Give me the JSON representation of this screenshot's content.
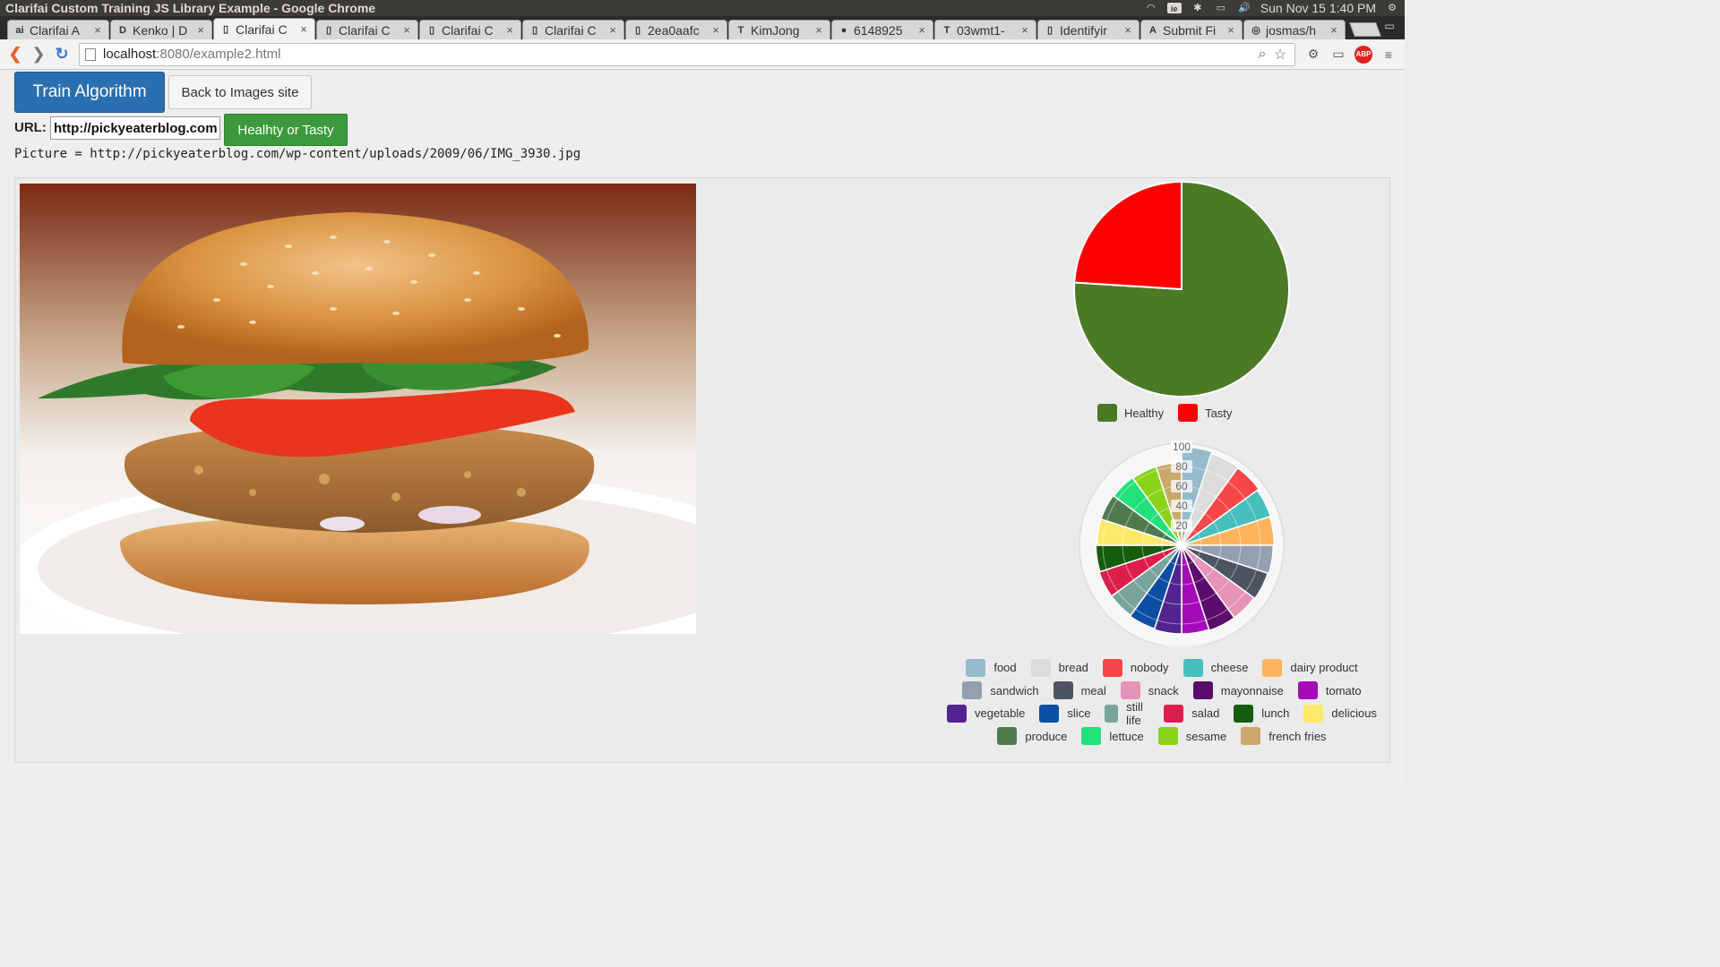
{
  "os": {
    "window_title": "Clarifai Custom Training JS Library Example - Google Chrome",
    "clock": "Sun Nov 15  1:40 PM"
  },
  "browser": {
    "tabs": [
      {
        "label": "Clarifai A",
        "favicon": "ai"
      },
      {
        "label": "Kenko | D",
        "favicon": "D"
      },
      {
        "label": "Clarifai C",
        "favicon": "page",
        "active": true
      },
      {
        "label": "Clarifai C",
        "favicon": "page"
      },
      {
        "label": "Clarifai C",
        "favicon": "page"
      },
      {
        "label": "Clarifai C",
        "favicon": "page"
      },
      {
        "label": "2ea0aafc",
        "favicon": "page"
      },
      {
        "label": "KimJong",
        "favicon": "T"
      },
      {
        "label": "6148925",
        "favicon": "flickr"
      },
      {
        "label": "03wmt1-",
        "favicon": "T"
      },
      {
        "label": "Identifyir",
        "favicon": "page"
      },
      {
        "label": "Submit Fi",
        "favicon": "A"
      },
      {
        "label": "josmas/h",
        "favicon": "github"
      }
    ],
    "url_host": "localhost",
    "url_path": ":8080/example2.html"
  },
  "page": {
    "train_button": "Train Algorithm",
    "back_button": "Back to Images site",
    "url_label": "URL:",
    "url_value": "http://pickyeaterblog.com/wp-content/uploads/2009/06/IMG_3930.jpg",
    "classify_button": "Healhty or Tasty",
    "picture_line": "Picture = http://pickyeaterblog.com/wp-content/uploads/2009/06/IMG_3930.jpg"
  },
  "chart_data": [
    {
      "type": "pie",
      "labels": [
        "Healthy",
        "Tasty"
      ],
      "values": [
        76,
        24
      ],
      "colors": [
        "#4a7a26",
        "#ff0000"
      ],
      "legend_position": "bottom"
    },
    {
      "type": "polarArea",
      "scale_ticks": [
        "100",
        "80",
        "60",
        "40",
        "20"
      ],
      "rlim": [
        0,
        100
      ],
      "labels": [
        "food",
        "bread",
        "nobody",
        "cheese",
        "dairy product",
        "sandwich",
        "meal",
        "snack",
        "mayonnaise",
        "tomato",
        "vegetable",
        "slice",
        "still life",
        "salad",
        "lunch",
        "delicious",
        "produce",
        "lettuce",
        "sesame",
        "french fries"
      ],
      "values": [
        100,
        98,
        97,
        95,
        94,
        93,
        92,
        91,
        91,
        90,
        90,
        89,
        88,
        88,
        87,
        86,
        86,
        85,
        84,
        84
      ],
      "colors": [
        "#97bbcd",
        "#dcdcdc",
        "#f7464a",
        "#46bfbd",
        "#fdb45c",
        "#949fb1",
        "#4d5360",
        "#e693b8",
        "#5b0d6b",
        "#a40bb8",
        "#51248f",
        "#0b4ea3",
        "#7aa49a",
        "#dc1f4a",
        "#155c0e",
        "#fde86a",
        "#4f7a4f",
        "#22e07a",
        "#8ad31b",
        "#c9a86a"
      ],
      "legend_position": "bottom"
    }
  ]
}
